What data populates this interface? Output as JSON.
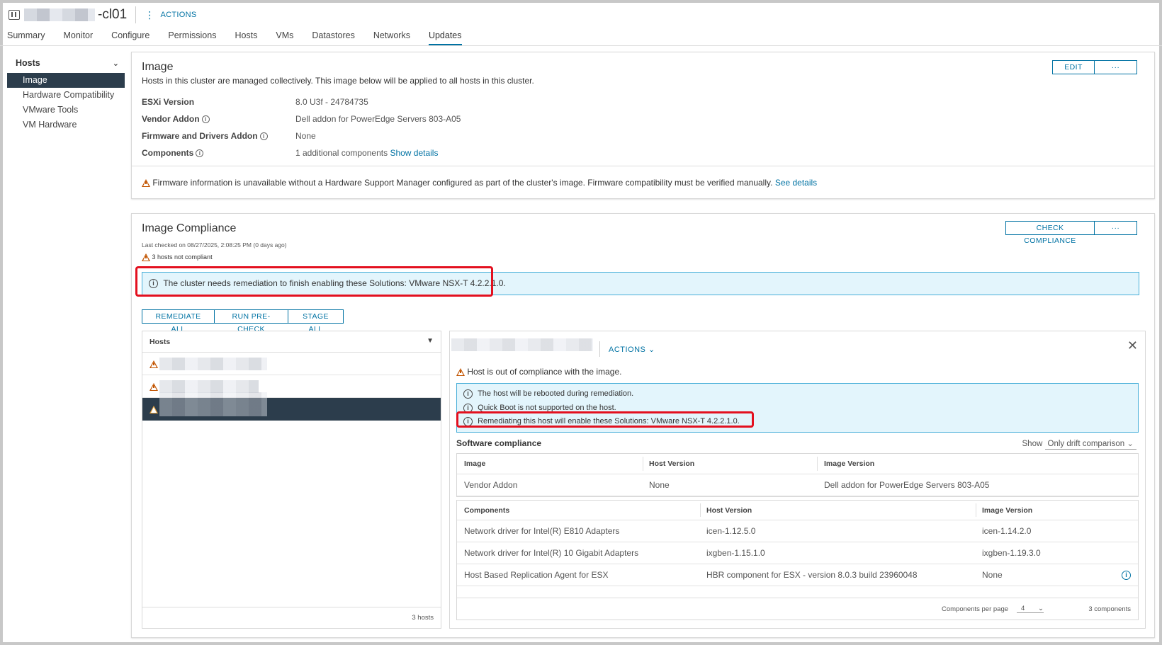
{
  "header": {
    "cluster_name": "-cl01",
    "actions_label": "ACTIONS"
  },
  "tabs": [
    {
      "label": "Summary"
    },
    {
      "label": "Monitor"
    },
    {
      "label": "Configure"
    },
    {
      "label": "Permissions"
    },
    {
      "label": "Hosts"
    },
    {
      "label": "VMs"
    },
    {
      "label": "Datastores"
    },
    {
      "label": "Networks"
    },
    {
      "label": "Updates",
      "active": true
    }
  ],
  "sidebar": {
    "section_label": "Hosts",
    "items": [
      {
        "label": "Image",
        "active": true
      },
      {
        "label": "Hardware Compatibility"
      },
      {
        "label": "VMware Tools"
      },
      {
        "label": "VM Hardware"
      }
    ]
  },
  "image_card": {
    "title": "Image",
    "subtitle": "Hosts in this cluster are managed collectively. This image below will be applied to all hosts in this cluster.",
    "edit_label": "EDIT",
    "more_label": "···",
    "fields": [
      {
        "label": "ESXi Version",
        "value": "8.0 U3f - 24784735"
      },
      {
        "label": "Vendor Addon",
        "value": "Dell addon for PowerEdge Servers 803-A05"
      },
      {
        "label": "Firmware and Drivers Addon",
        "value": "None"
      },
      {
        "label": "Components",
        "value": "1 additional components",
        "link": "Show details"
      }
    ],
    "firmware_warning": "Firmware information is unavailable without a Hardware Support Manager configured as part of the cluster's image. Firmware compatibility must be verified manually.",
    "firmware_link": "See details"
  },
  "compliance": {
    "title": "Image Compliance",
    "check_label": "CHECK COMPLIANCE",
    "more_label": "···",
    "last_checked": "Last checked on 08/27/2025, 2:08:25 PM (0 days ago)",
    "not_compliant": "3 hosts not compliant",
    "cluster_banner": "The cluster needs remediation to finish enabling these Solutions: VMware NSX-T 4.2.2.1.0.",
    "buttons": {
      "remediate_all": "REMEDIATE ALL",
      "run_precheck": "RUN PRE-CHECK",
      "stage_all": "STAGE ALL"
    },
    "hosts_list": {
      "header": "Hosts",
      "footer": "3 hosts"
    },
    "host_detail": {
      "actions_label": "ACTIONS",
      "status": "Host is out of compliance with the image.",
      "messages": [
        "The host will be rebooted during remediation.",
        "Quick Boot is not supported on the host.",
        "Remediating this host will enable these Solutions: VMware NSX-T 4.2.2.1.0."
      ],
      "software_title": "Software compliance",
      "show_label": "Show",
      "show_value": "Only drift comparison",
      "image_table": {
        "headers": [
          "Image",
          "Host Version",
          "Image Version"
        ],
        "rows": [
          [
            "Vendor Addon",
            "None",
            "Dell addon for PowerEdge Servers 803-A05"
          ]
        ]
      },
      "components_table": {
        "headers": [
          "Components",
          "Host Version",
          "Image Version"
        ],
        "rows": [
          [
            "Network driver for Intel(R) E810 Adapters",
            "icen-1.12.5.0",
            "icen-1.14.2.0"
          ],
          [
            "Network driver for Intel(R) 10 Gigabit Adapters",
            "ixgben-1.15.1.0",
            "ixgben-1.19.3.0"
          ],
          [
            "Host Based Replication Agent for ESX",
            "HBR component for ESX - version 8.0.3 build 23960048",
            "None"
          ]
        ]
      },
      "pager": {
        "per_page_label": "Components per page",
        "per_page_value": "4",
        "count": "3 components"
      }
    }
  }
}
